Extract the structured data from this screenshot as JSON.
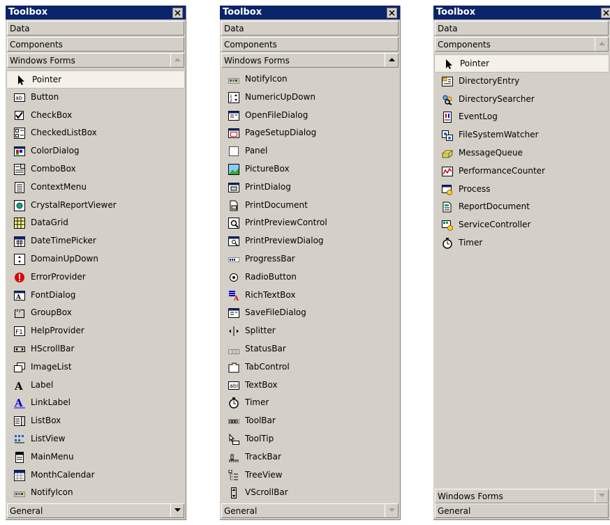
{
  "panels": [
    {
      "title": "Toolbox",
      "top_tabs": [
        "Data",
        "Components",
        "Windows Forms"
      ],
      "active_scroll": "up-disabled",
      "items": [
        {
          "label": "Pointer",
          "icon": "pointer-icon"
        },
        {
          "label": "Button",
          "icon": "button-icon"
        },
        {
          "label": "CheckBox",
          "icon": "checkbox-icon"
        },
        {
          "label": "CheckedListBox",
          "icon": "checkedlistbox-icon"
        },
        {
          "label": "ColorDialog",
          "icon": "colordialog-icon"
        },
        {
          "label": "ComboBox",
          "icon": "combobox-icon"
        },
        {
          "label": "ContextMenu",
          "icon": "contextmenu-icon"
        },
        {
          "label": "CrystalReportViewer",
          "icon": "crystalreport-icon"
        },
        {
          "label": "DataGrid",
          "icon": "datagrid-icon"
        },
        {
          "label": "DateTimePicker",
          "icon": "datetimepicker-icon"
        },
        {
          "label": "DomainUpDown",
          "icon": "domainupdown-icon"
        },
        {
          "label": "ErrorProvider",
          "icon": "errorprovider-icon"
        },
        {
          "label": "FontDialog",
          "icon": "fontdialog-icon"
        },
        {
          "label": "GroupBox",
          "icon": "groupbox-icon"
        },
        {
          "label": "HelpProvider",
          "icon": "helpprovider-icon"
        },
        {
          "label": "HScrollBar",
          "icon": "hscrollbar-icon"
        },
        {
          "label": "ImageList",
          "icon": "imagelist-icon"
        },
        {
          "label": "Label",
          "icon": "label-icon"
        },
        {
          "label": "LinkLabel",
          "icon": "linklabel-icon"
        },
        {
          "label": "ListBox",
          "icon": "listbox-icon"
        },
        {
          "label": "ListView",
          "icon": "listview-icon"
        },
        {
          "label": "MainMenu",
          "icon": "mainmenu-icon"
        },
        {
          "label": "MonthCalendar",
          "icon": "monthcalendar-icon"
        },
        {
          "label": "NotifyIcon",
          "icon": "notifyicon-icon"
        }
      ],
      "bottom_tabs": [
        "General"
      ]
    },
    {
      "title": "Toolbox",
      "top_tabs": [
        "Data",
        "Components",
        "Windows Forms"
      ],
      "active_scroll": "up",
      "items": [
        {
          "label": "NotifyIcon",
          "icon": "notifyicon-icon"
        },
        {
          "label": "NumericUpDown",
          "icon": "numericupdown-icon"
        },
        {
          "label": "OpenFileDialog",
          "icon": "openfiledialog-icon"
        },
        {
          "label": "PageSetupDialog",
          "icon": "pagesetupdialog-icon"
        },
        {
          "label": "Panel",
          "icon": "panel-icon"
        },
        {
          "label": "PictureBox",
          "icon": "picturebox-icon"
        },
        {
          "label": "PrintDialog",
          "icon": "printdialog-icon"
        },
        {
          "label": "PrintDocument",
          "icon": "printdocument-icon"
        },
        {
          "label": "PrintPreviewControl",
          "icon": "printpreviewcontrol-icon"
        },
        {
          "label": "PrintPreviewDialog",
          "icon": "printpreviewdialog-icon"
        },
        {
          "label": "ProgressBar",
          "icon": "progressbar-icon"
        },
        {
          "label": "RadioButton",
          "icon": "radiobutton-icon"
        },
        {
          "label": "RichTextBox",
          "icon": "richtextbox-icon"
        },
        {
          "label": "SaveFileDialog",
          "icon": "savefiledialog-icon"
        },
        {
          "label": "Splitter",
          "icon": "splitter-icon"
        },
        {
          "label": "StatusBar",
          "icon": "statusbar-icon"
        },
        {
          "label": "TabControl",
          "icon": "tabcontrol-icon"
        },
        {
          "label": "TextBox",
          "icon": "textbox-icon"
        },
        {
          "label": "Timer",
          "icon": "timer-icon"
        },
        {
          "label": "ToolBar",
          "icon": "toolbar-icon"
        },
        {
          "label": "ToolTip",
          "icon": "tooltip-icon"
        },
        {
          "label": "TrackBar",
          "icon": "trackbar-icon"
        },
        {
          "label": "TreeView",
          "icon": "treeview-icon"
        },
        {
          "label": "VScrollBar",
          "icon": "vscrollbar-icon"
        }
      ],
      "bottom_tabs": [
        "General"
      ]
    },
    {
      "title": "Toolbox",
      "top_tabs": [
        "Data",
        "Components"
      ],
      "items": [
        {
          "label": "Pointer",
          "icon": "pointer-icon"
        },
        {
          "label": "DirectoryEntry",
          "icon": "directoryentry-icon"
        },
        {
          "label": "DirectorySearcher",
          "icon": "directorysearcher-icon"
        },
        {
          "label": "EventLog",
          "icon": "eventlog-icon"
        },
        {
          "label": "FileSystemWatcher",
          "icon": "filesystemwatcher-icon"
        },
        {
          "label": "MessageQueue",
          "icon": "messagequeue-icon"
        },
        {
          "label": "PerformanceCounter",
          "icon": "performancecounter-icon"
        },
        {
          "label": "Process",
          "icon": "process-icon"
        },
        {
          "label": "ReportDocument",
          "icon": "reportdocument-icon"
        },
        {
          "label": "ServiceController",
          "icon": "servicecontroller-icon"
        },
        {
          "label": "Timer",
          "icon": "timer-icon"
        }
      ],
      "bottom_tabs": [
        "Windows Forms",
        "General"
      ]
    }
  ],
  "colors": {
    "titlebar": "#0a246a",
    "panel": "#d4d0c8",
    "selected": "#f4f1ea"
  }
}
